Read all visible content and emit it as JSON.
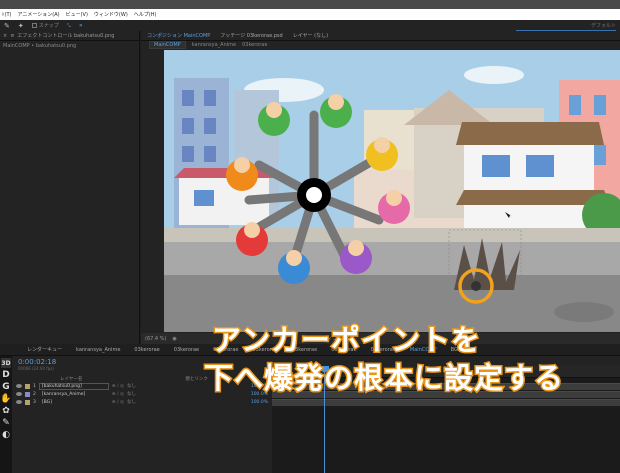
{
  "menu": [
    "ﾄ(T)",
    "アニメーション(A)",
    "ビュー(V)",
    "ウィンドウ(W)",
    "ヘルプ(H)"
  ],
  "toolbar": {
    "snap_label": "スナップ",
    "workspace": "デフォルト"
  },
  "project_panel": {
    "tab_label": "エフェクトコントロール bakuhatsu0.png",
    "sub_label": "MainCOMP • bakuhatsu0.png"
  },
  "comp_panel": {
    "tabs": [
      "コンポジション MainCOMP",
      "フッテージ 03kerorae.psd",
      "レイヤー (なし)"
    ],
    "breadcrumbs": [
      "MainCOMP",
      "kanransya_Anime",
      "03kerorae"
    ],
    "viewer_zoom": "(67.4 %)",
    "viewer_bottom_label": "アクティブ"
  },
  "timeline": {
    "tabs": [
      "レンダーキュー",
      "kanransya_Anime",
      "03kerorae",
      "03kerorae",
      "03kerorae",
      "03kerorae",
      "03kerorae",
      "03kerorae",
      "03kerorae",
      "MainCOMP",
      "BG"
    ],
    "active_tab_index": 9,
    "timecode": "0:00:02:18",
    "timecode_sub": "00066 (24.00 fps)",
    "column_label": "レイヤー名",
    "parent_label": "親とリンク",
    "layers": [
      {
        "num": "1",
        "name": "[bakuhatsu0.png]",
        "mode": "なし",
        "pct": "100.0%",
        "color": "#b5a36a"
      },
      {
        "num": "2",
        "name": "[kanransya_Anime]",
        "mode": "なし",
        "pct": "100.0%",
        "color": "#8a8ac8"
      },
      {
        "num": "3",
        "name": "[BG]",
        "mode": "なし",
        "pct": "100.0%",
        "color": "#b5a36a"
      }
    ]
  },
  "left_tools": [
    "3D",
    "D",
    "G"
  ],
  "caption": {
    "line1": "アンカーポイントを",
    "line2": "下へ爆発の根本に設定する"
  },
  "colors": {
    "accent": "#4a90d9",
    "caption_stroke": "#e8951a",
    "anchor_ring": "#f2a21c"
  }
}
